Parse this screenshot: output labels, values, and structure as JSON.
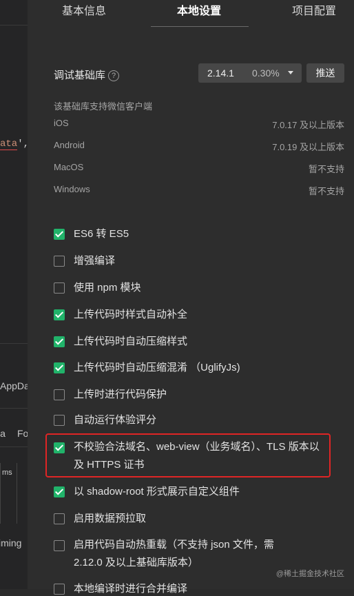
{
  "left_pane": {
    "code_fragment": "ata",
    "code_punct": "',",
    "tab1": "AppDa",
    "tab2": "ia",
    "tab3": "Fo",
    "col_header": "ms",
    "timing": "iming"
  },
  "tabs": [
    {
      "label": "基本信息",
      "active": false
    },
    {
      "label": "本地设置",
      "active": true
    },
    {
      "label": "项目配置",
      "active": false
    }
  ],
  "debug_lib": {
    "label": "调试基础库",
    "help_icon": "?",
    "version": "2.14.1",
    "share": "0.30%",
    "push_button": "推送"
  },
  "support": {
    "title": "该基础库支持微信客户端",
    "rows": [
      {
        "platform": "iOS",
        "status": "7.0.17 及以上版本"
      },
      {
        "platform": "Android",
        "status": "7.0.19 及以上版本"
      },
      {
        "platform": "MacOS",
        "status": "暂不支持"
      },
      {
        "platform": "Windows",
        "status": "暂不支持"
      }
    ]
  },
  "options": [
    {
      "label": "ES6 转 ES5",
      "checked": true
    },
    {
      "label": "增强编译",
      "checked": false
    },
    {
      "label": "使用 npm 模块",
      "checked": false
    },
    {
      "label": "上传代码时样式自动补全",
      "checked": true
    },
    {
      "label": "上传代码时自动压缩样式",
      "checked": true
    },
    {
      "label": "上传代码时自动压缩混淆 （UglifyJs)",
      "checked": true
    },
    {
      "label": "上传时进行代码保护",
      "checked": false
    },
    {
      "label": "自动运行体验评分",
      "checked": false
    },
    {
      "label": "不校验合法域名、web-view（业务域名）、TLS 版本以及 HTTPS 证书",
      "checked": true
    },
    {
      "label": "以 shadow-root 形式展示自定义组件",
      "checked": true
    },
    {
      "label": "启用数据预拉取",
      "checked": false
    },
    {
      "label": "启用代码自动热重载（不支持 json 文件，需 2.12.0 及以上基础库版本）",
      "checked": false
    },
    {
      "label": "本地编译时进行合并编译",
      "checked": false
    }
  ],
  "watermark": "@稀土掘金技术社区",
  "colors": {
    "accent_green": "#21b36a",
    "highlight_red": "#e02525"
  }
}
